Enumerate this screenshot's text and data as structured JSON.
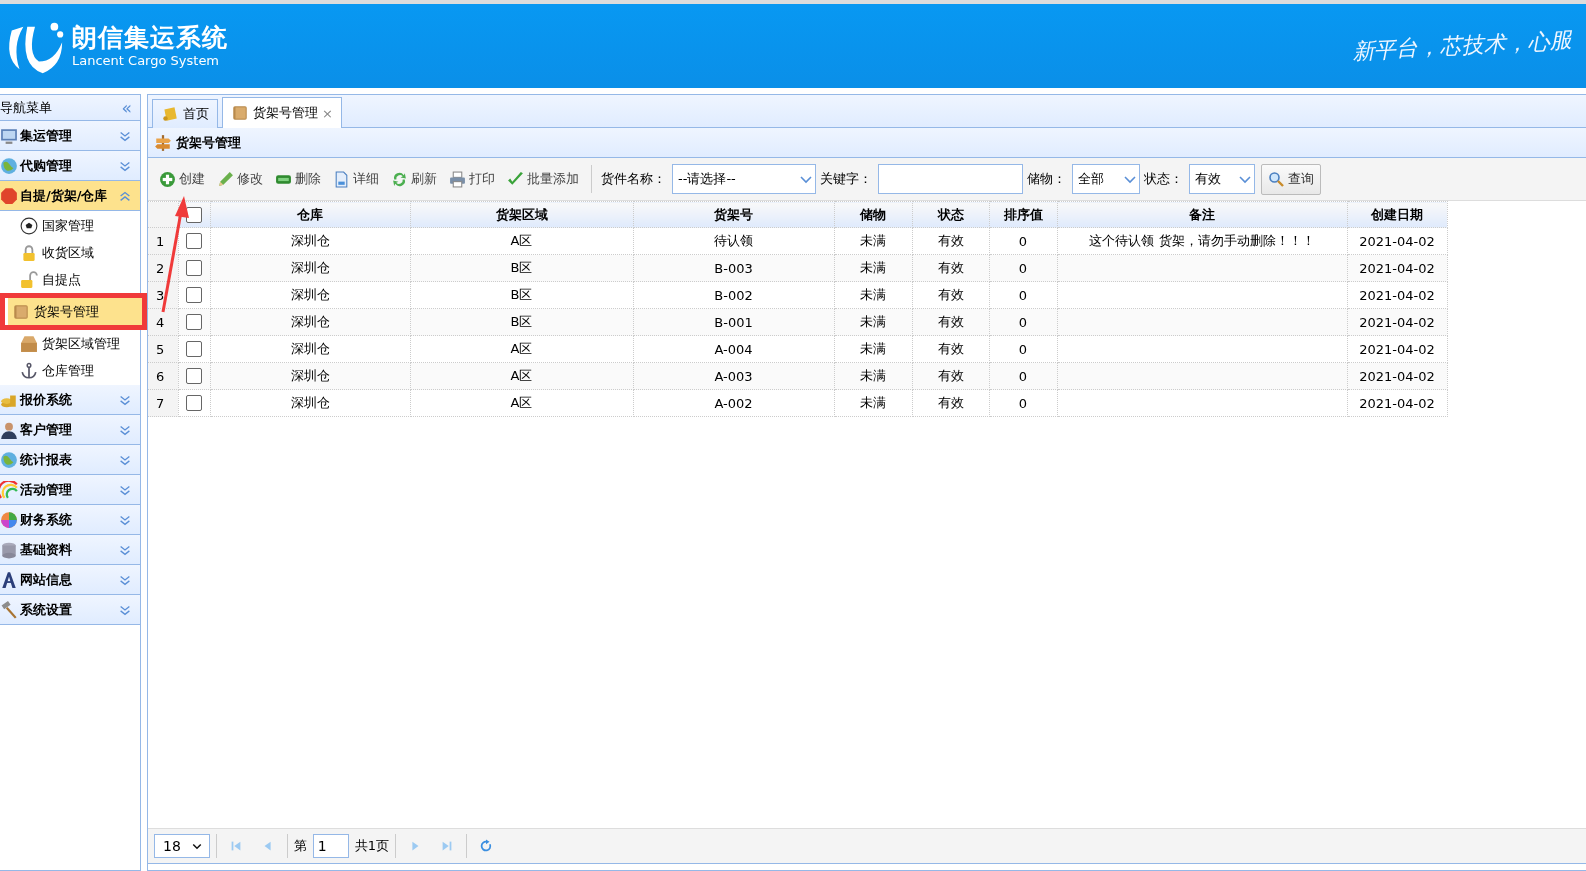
{
  "header": {
    "title": "朗信集运系统",
    "subtitle": "Lancent Cargo System",
    "slogan": "新平台，芯技术，心服"
  },
  "sidebar": {
    "title": "导航菜单",
    "collapse_glyph": "«",
    "sections": [
      {
        "label": "集运管理",
        "expanded": false
      },
      {
        "label": "代购管理",
        "expanded": false
      },
      {
        "label": "自提/货架/仓库",
        "expanded": true,
        "items": [
          {
            "label": "国家管理",
            "selected": false
          },
          {
            "label": "收货区域",
            "selected": false
          },
          {
            "label": "自提点",
            "selected": false
          },
          {
            "label": "货架号管理",
            "selected": true
          },
          {
            "label": "货架区域管理",
            "selected": false
          },
          {
            "label": "仓库管理",
            "selected": false
          }
        ]
      },
      {
        "label": "报价系统",
        "expanded": false
      },
      {
        "label": "客户管理",
        "expanded": false
      },
      {
        "label": "统计报表",
        "expanded": false
      },
      {
        "label": "活动管理",
        "expanded": false
      },
      {
        "label": "财务系统",
        "expanded": false
      },
      {
        "label": "基础资料",
        "expanded": false
      },
      {
        "label": "网站信息",
        "expanded": false
      },
      {
        "label": "系统设置",
        "expanded": false
      }
    ]
  },
  "tabs": [
    {
      "label": "首页",
      "selected": false,
      "closable": false
    },
    {
      "label": "货架号管理",
      "selected": true,
      "closable": true,
      "close_glyph": "×"
    }
  ],
  "panel": {
    "title": "货架号管理"
  },
  "toolbar": {
    "buttons": [
      "创建",
      "修改",
      "删除",
      "详细",
      "刷新",
      "打印",
      "批量添加"
    ],
    "filters": [
      {
        "kind": "select",
        "label": "货件名称：",
        "value": "--请选择--"
      },
      {
        "kind": "input",
        "label": "关键字："
      },
      {
        "kind": "select",
        "label": "储物：",
        "value": "全部"
      },
      {
        "kind": "select",
        "label": "状态：",
        "value": "有效"
      }
    ],
    "search_button": "查询"
  },
  "table": {
    "all_checked": false,
    "columns": [
      "仓库",
      "货架区域",
      "货架号",
      "储物",
      "状态",
      "排序值",
      "备注",
      "创建日期"
    ],
    "rows": [
      {
        "index": "1",
        "checked": false,
        "cells": [
          "深圳仓",
          "A区",
          "待认领",
          "未满",
          "有效",
          "0",
          "这个待认领 货架，请勿手动删除！！！",
          "2021-04-02"
        ]
      },
      {
        "index": "2",
        "checked": false,
        "cells": [
          "深圳仓",
          "B区",
          "B-003",
          "未满",
          "有效",
          "0",
          "",
          "2021-04-02"
        ]
      },
      {
        "index": "3",
        "checked": false,
        "cells": [
          "深圳仓",
          "B区",
          "B-002",
          "未满",
          "有效",
          "0",
          "",
          "2021-04-02"
        ]
      },
      {
        "index": "4",
        "checked": false,
        "cells": [
          "深圳仓",
          "B区",
          "B-001",
          "未满",
          "有效",
          "0",
          "",
          "2021-04-02"
        ]
      },
      {
        "index": "5",
        "checked": false,
        "cells": [
          "深圳仓",
          "A区",
          "A-004",
          "未满",
          "有效",
          "0",
          "",
          "2021-04-02"
        ]
      },
      {
        "index": "6",
        "checked": false,
        "cells": [
          "深圳仓",
          "A区",
          "A-003",
          "未满",
          "有效",
          "0",
          "",
          "2021-04-02"
        ]
      },
      {
        "index": "7",
        "checked": false,
        "cells": [
          "深圳仓",
          "A区",
          "A-002",
          "未满",
          "有效",
          "0",
          "",
          "2021-04-02"
        ]
      }
    ]
  },
  "pagination": {
    "page_size": "18",
    "page_prefix": "第",
    "page": "1",
    "total": "共1页"
  }
}
